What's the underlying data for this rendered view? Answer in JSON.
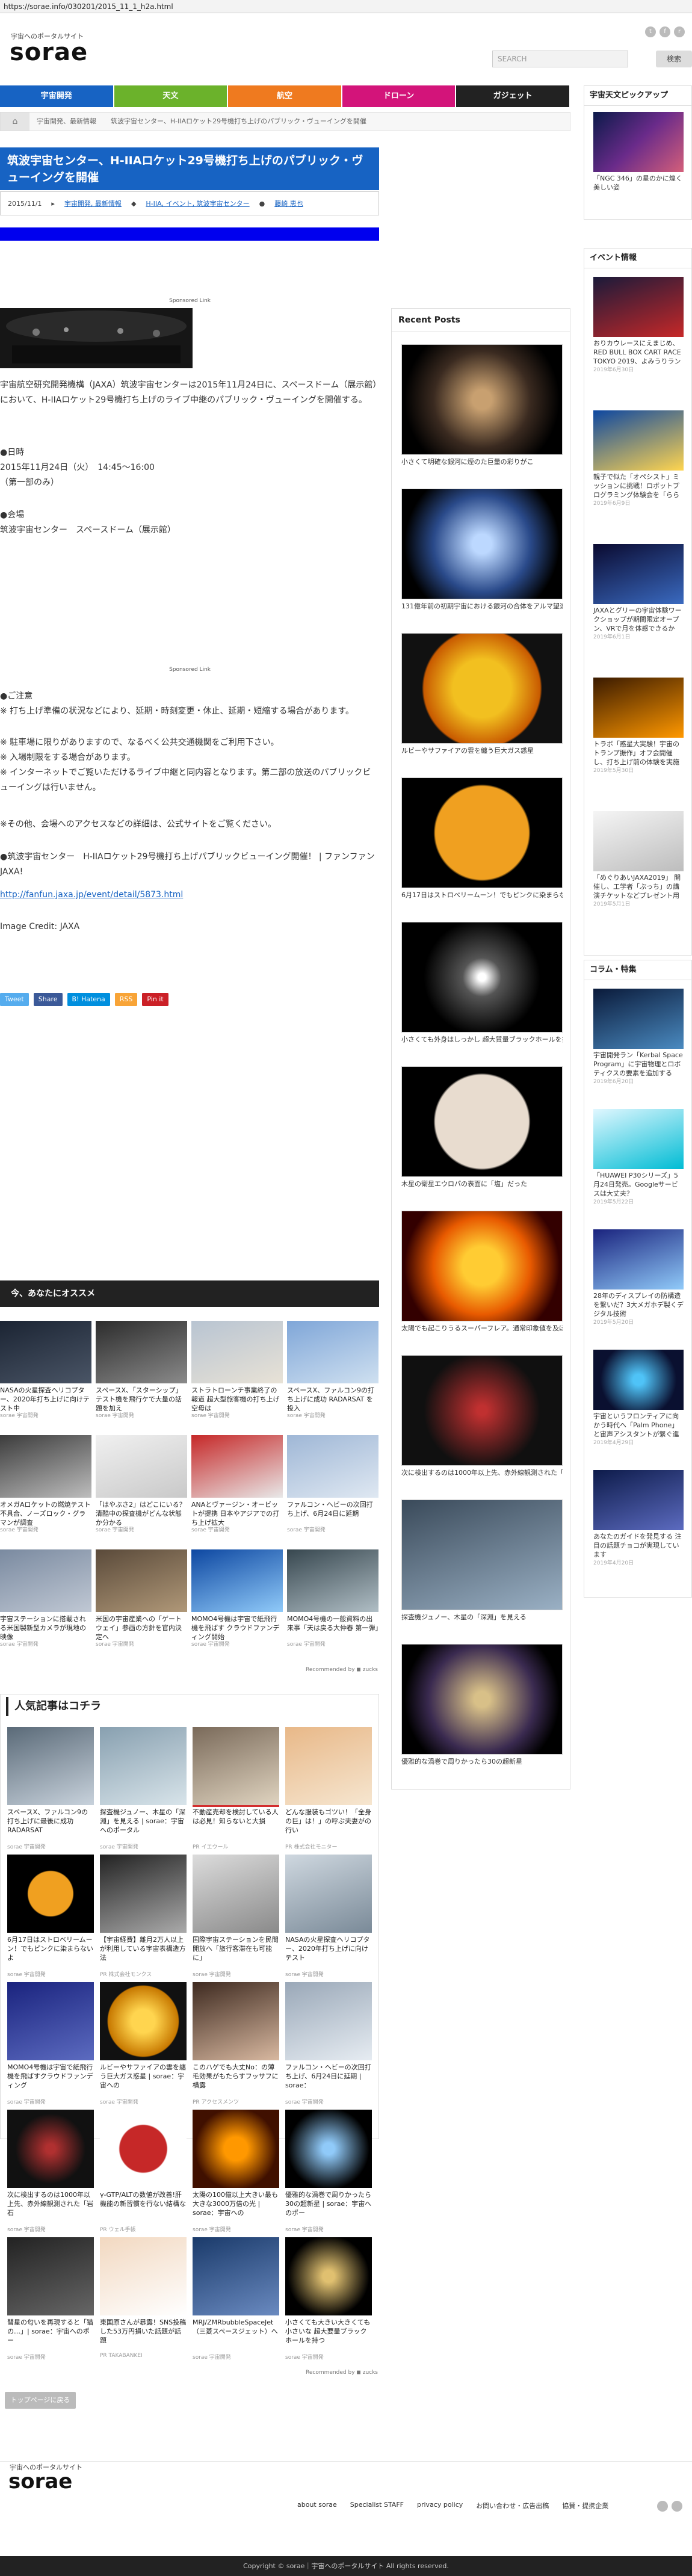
{
  "url": "https://sorae.info/030201/2015_11_1_h2a.html",
  "header": {
    "logo_tag": "宇宙へのポータルサイト",
    "logo": "sorae",
    "search_placeholder": "SEARCH",
    "search_button": "検索"
  },
  "nav": [
    {
      "label": "宇宙開発",
      "color": "#1763c3"
    },
    {
      "label": "天文",
      "color": "#6bb22b"
    },
    {
      "label": "航空",
      "color": "#ef7a1f"
    },
    {
      "label": "ドローン",
      "color": "#d3147a"
    },
    {
      "label": "ガジェット",
      "color": "#222222"
    }
  ],
  "breadcrumb": [
    "宇宙開発、最新情報",
    "筑波宇宙センター、H-IIAロケット29号機打ち上げのパブリック・ヴューイングを開催"
  ],
  "article": {
    "title": "筑波宇宙センター、H-IIAロケット29号機打ち上げのパブリック・ヴューイングを開催",
    "date": "2015/11/1",
    "categories": "宇宙開発, 最新情報",
    "tags": "H-IIA, イベント, 筑波宇宙センター",
    "author": "藤崎 恵也",
    "sponsored": "Sponsored Link",
    "intro": "宇宙航空研究開発機構（JAXA）筑波宇宙センターは2015年11月24日に、スペースドーム（展示館）において、H-IIAロケット29号機打ち上げのライブ中継のパブリック・ヴューイングを開催する。",
    "date_heading": "●日時",
    "date_line1": "2015年11月24日（火）　14:45〜16:00",
    "date_line2": "（第一部のみ）",
    "venue_heading": "●会場",
    "venue_line": "筑波宇宙センター　スペースドーム（展示館）",
    "notes_heading": "●ご注意",
    "note1": "※ 打ち上げ準備の状況などにより、延期・時刻変更・休止、延期・短縮する場合があります。",
    "note2": "※ 駐車場に限りがありますので、なるべく公共交通機関をご利用下さい。",
    "note3": "※ 入場制限をする場合があります。",
    "note4": "※ インターネットでご覧いただけるライブ中継と同内容となります。第二部の放送のパブリックビューイングは行いません。",
    "note5": "※その他、会場へのアクセスなどの詳細は、公式サイトをご覧ください。",
    "link_text": "●筑波宇宙センター　H-IIAロケット29号機打ち上げパブリックビューイング開催！ | ファンファンJAXA!",
    "link_url": "http://fanfun.jaxa.jp/event/detail/5873.html",
    "credit": "Image Credit: JAXA"
  },
  "share": [
    {
      "label": "Tweet",
      "color": "#55acee"
    },
    {
      "label": "Share",
      "color": "#3b5998"
    },
    {
      "label": "B! Hatena",
      "color": "#008fde"
    },
    {
      "label": "RSS",
      "color": "#f8a437"
    },
    {
      "label": "Pin it",
      "color": "#cb2027"
    }
  ],
  "reco": {
    "heading": "今、あなたにオススメ",
    "footer": "Recommended by ◼ zucks",
    "items": [
      {
        "cap": "NASAの火星探査ヘリコプター、2020年打ち上げに向けテスト中",
        "src": "sorae 宇宙開発"
      },
      {
        "cap": "スペースX、「スターシップ」テスト機を飛行ケで大量の話題を加え",
        "src": "sorae 宇宙開発"
      },
      {
        "cap": "ストラトローンチ事業終了の報道 超大型旅客機の打ち上げ空母は",
        "src": "sorae 宇宙開発"
      },
      {
        "cap": "スペースX、ファルコン9の打ち上げに成功 RADARSAT を投入",
        "src": "sorae 宇宙開発"
      },
      {
        "cap": "オメガAロケットの燃焼テスト不具合、ノーズロック・グラマンが調査",
        "src": "sorae 宇宙開発"
      },
      {
        "cap": "「はやぶさ2」はどこにいる？ 清酷中の探査機がどんな状態か分かる",
        "src": "sorae 宇宙開発"
      },
      {
        "cap": "ANAとヴァージン・オービットが提携 日本やアジアでの打ち上げ拡大",
        "src": "sorae 宇宙開発"
      },
      {
        "cap": "ファルコン・ヘビーの次回打ち上げ、6月24日に延期",
        "src": "sorae 宇宙開発"
      },
      {
        "cap": "宇宙ステーションに搭載される米国製新型カメラが現地の映像",
        "src": "sorae 宇宙開発"
      },
      {
        "cap": "米国の宇宙産業への「ゲートウェイ」参画の方針を官内決定へ",
        "src": "sorae 宇宙開発"
      },
      {
        "cap": "MOMO4号機は宇宙で紙飛行機を飛ばす クラウドファンディング開始",
        "src": "sorae 宇宙開発"
      },
      {
        "cap": "MOMO4号機の一般資料の出来事「天は戻る大仲春 第一弾」",
        "src": "sorae 宇宙開発"
      }
    ]
  },
  "popular": {
    "heading": "人気記事はコチラ",
    "footer": "Recommended by ◼ zucks",
    "items": [
      {
        "cap": "スペースX、ファルコン9の打ち上げに最後に成功 RADARSAT",
        "src": "sorae 宇宙開発"
      },
      {
        "cap": "探査機ジュノー、木星の「深淵」を見える | sorae：宇宙へのポータル",
        "src": "sorae 宇宙開発"
      },
      {
        "cap": "不動産売却を検討している人は必見！知らないと大損",
        "src": "PR イエウール"
      },
      {
        "cap": "どんな服装もゴツい！「全身の巨」は！」の呼ぶ夫妻がの行い",
        "src": "PR 株式会社モニター"
      },
      {
        "cap": "6月17日はストロベリームーン！でもピンクに染まらないよ",
        "src": "sorae 宇宙開発"
      },
      {
        "cap": "【宇宙経費】離月2万人以上が利用している宇宙表構造方法",
        "src": "PR 株式会社モンクス"
      },
      {
        "cap": "国際宇宙ステーションを民間開放へ「旅行客滞在も可能に」",
        "src": "sorae 宇宙開発"
      },
      {
        "cap": "NASAの火星探査ヘリコプター、2020年打ち上げに向けテスト",
        "src": "sorae 宇宙開発"
      },
      {
        "cap": "MOMO4号機は宇宙で紙飛行機を飛ばすクラウドファンディング",
        "src": "sorae 宇宙開発"
      },
      {
        "cap": "ルビーやサファイアの雲を纏う巨大ガス惑星 | sorae：宇宙への",
        "src": "sorae 宇宙開発"
      },
      {
        "cap": "このハゲでも大丈No：の薄毛効果がもたらすフッサフに横露",
        "src": "PR アクセスメンツ"
      },
      {
        "cap": "ファルコン・ヘビーの次回打ち上げ、6月24日に延期 | sorae：",
        "src": "sorae 宇宙開発"
      },
      {
        "cap": "次に検出するのは1000年以上先、赤外線観測された「岩石",
        "src": "sorae 宇宙開発"
      },
      {
        "cap": "γ-GTP/ALTの数値が改善!肝機能の新習慣を行ない結構な",
        "src": "PR ウェル手帳"
      },
      {
        "cap": "太陽の100億以上大きい最も大きな3000万倍の光 | sorae：宇宙への",
        "src": "sorae 宇宙開発"
      },
      {
        "cap": "優雅的な渦巻で周りかったら30の超新星 | sorae：宇宙へのポー",
        "src": "sorae 宇宙開発"
      },
      {
        "cap": "彗星の匂いを再現すると「猫の…」| sorae：宇宙へのポー",
        "src": "sorae 宇宙開発"
      },
      {
        "cap": "東国原さんが暴露！SNS投稿した53万円損いた話題が話題",
        "src": "PR TAKABANKEI"
      },
      {
        "cap": "MRJ/ZMRbubbleSpaceJet（三菱スペースジェット）へ",
        "src": "sorae 宇宙開発"
      },
      {
        "cap": "小さくても大きい大きくても小さいな 超大要量ブラックホールを持つ",
        "src": "sorae 宇宙開発"
      }
    ]
  },
  "toppage": "トップページに戻る",
  "recent": {
    "heading": "Recent Posts",
    "items": [
      {
        "cap": "小さくて明確な銀河に煙のた巨量の彩りがこ"
      },
      {
        "cap": "131億年前の初期宇宙における銀河の合体をアルマ望遠鏡が観測"
      },
      {
        "cap": "ルビーやサファイアの雲を纏う巨大ガス惑星"
      },
      {
        "cap": "6月17日はストロベリームーン！でもピンクに染まらないよ"
      },
      {
        "cap": "小さくても外身はしっかし 超大質量ブラックホールを持つ矮小銀河"
      },
      {
        "cap": "木星の衛星エウロパの表面に「塩」だった"
      },
      {
        "cap": "太陽でも起こりうるスーパーフレア。通常印象値を及ぼす頻度は「いつ」起こるのか"
      },
      {
        "cap": "次に検出するのは1000年以上先、赤外線観測された「岩石"
      },
      {
        "cap": "探査機ジュノー、木星の「深淵」を見える"
      },
      {
        "cap": "優雅的な渦巻で周りかったら30の超新星"
      }
    ]
  },
  "sidebar": {
    "pickup_heading": "宇宙天文ピックアップ",
    "pickup_item": {
      "cap": "「NGC 346」の星のかに煌く美しい姿",
      "date": ""
    },
    "events_heading": "イベント情報",
    "events": [
      {
        "cap": "おりカウレースにえまじめ、RED BULL BOX CART RACE TOKYO 2019、よみうりランドで開催",
        "date": "2019年6月30日"
      },
      {
        "cap": "親子で似た「オペシスト」ミッションに挑戦！ロボットプログラミング体験会を「ららぽーと新三郷」で6/9に開催",
        "date": "2019年6月9日"
      },
      {
        "cap": "JAXAとグリーの宇宙体験ワークショップが期間限定オープン、VRで月を体感できるかも！",
        "date": "2019年6月1日"
      },
      {
        "cap": "トラボ「惑星大実験！宇宙のトランプ振作」オフ会開催し、打ち上げ前の体験を実施",
        "date": "2019年5月30日"
      },
      {
        "cap": "「めぐりあいJAXA2019」 開催し、工学者「ぷっち」の講演チケットなどプレゼント用抽選会",
        "date": "2019年5月1日"
      }
    ],
    "column_heading": "コラム・特集",
    "columns": [
      {
        "cap": "宇宙開発ラン「Kerbal Space Program」に宇宙物理とロボティクスの要素を追加するDLCが登場！",
        "date": "2019年6月20日"
      },
      {
        "cap": "「HUAWEI P30シリーズ」5月24日発売。Googleサービスは大丈夫？",
        "date": "2019年5月22日"
      },
      {
        "cap": "28年のディスプレイの防構造を繋いだ？3大メガホデ製くデジタル技術",
        "date": "2019年5月20日"
      },
      {
        "cap": "宇宙というフロンティアに向かう時代へ「Palm Phone」と宙声アシスタントが繋ぐ進化",
        "date": "2019年4月29日"
      },
      {
        "cap": "あなたのガイドを発見する 注目の話題チョコが実現しています",
        "date": "2019年4月20日"
      }
    ]
  },
  "footer": {
    "logo_tag": "宇宙へのポータルサイト",
    "logo": "sorae",
    "links": [
      "about sorae",
      "Specialist STAFF",
      "privacy policy",
      "お問い合わせ・広告出稿",
      "協賛・提携企業"
    ],
    "copyright": "Copyright © sorae｜宇宙へのポータルサイト All rights reserved."
  }
}
